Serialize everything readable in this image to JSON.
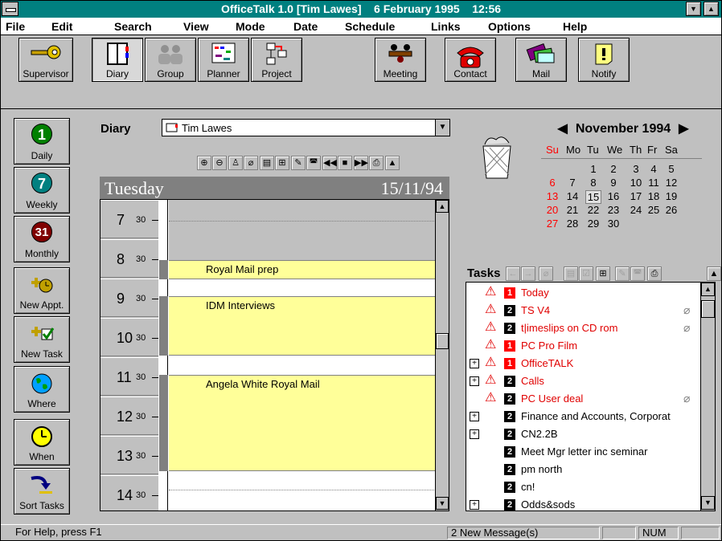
{
  "title": "OfficeTalk 1.0 [Tim Lawes]    6 February 1995    12:56",
  "menu": [
    "File",
    "Edit",
    "Search",
    "View",
    "Mode",
    "Date",
    "Schedule",
    "Links",
    "Options",
    "Help"
  ],
  "toolbar": [
    "Supervisor",
    "Diary",
    "Group",
    "Planner",
    "Project",
    "Meeting",
    "Contact",
    "Mail",
    "Notify"
  ],
  "sidebar": [
    {
      "icon": "1",
      "label": "Daily",
      "color": "#008000"
    },
    {
      "icon": "7",
      "label": "Weekly",
      "color": "#008080"
    },
    {
      "icon": "31",
      "label": "Monthly",
      "color": "#800000"
    },
    {
      "label": "New Appt."
    },
    {
      "label": "New Task"
    },
    {
      "label": "Where"
    },
    {
      "label": "When"
    },
    {
      "label": "Sort Tasks"
    }
  ],
  "diary": {
    "label": "Diary",
    "owner": "Tim Lawes",
    "day": "Tuesday",
    "date": "15/11/94",
    "hours": [
      "7",
      "8",
      "9",
      "10",
      "11",
      "12",
      "13",
      "14"
    ],
    "half": "30",
    "appointments": [
      "Royal Mail prep",
      "IDM Interviews",
      "Angela White Royal Mail"
    ]
  },
  "calendar": {
    "month": "November 1994",
    "weekdays": [
      "Su",
      "Mo",
      "Tu",
      "We",
      "Th",
      "Fr",
      "Sa"
    ],
    "weeks": [
      [
        "",
        "",
        "1",
        "2",
        "3",
        "4",
        "5"
      ],
      [
        "6",
        "7",
        "8",
        "9",
        "10",
        "11",
        "12"
      ],
      [
        "13",
        "14",
        "15",
        "16",
        "17",
        "18",
        "19"
      ],
      [
        "20",
        "21",
        "22",
        "23",
        "24",
        "25",
        "26"
      ],
      [
        "27",
        "28",
        "29",
        "30",
        "",
        "",
        ""
      ]
    ],
    "selected": "15",
    "sunday_color": "#ff0000"
  },
  "tasks": {
    "label": "Tasks",
    "items": [
      {
        "text": "Today",
        "pri": "1",
        "warn": true,
        "red": true,
        "exp": false,
        "clip": false
      },
      {
        "text": "TS V4",
        "pri": "2",
        "warn": true,
        "red": true,
        "exp": false,
        "clip": true
      },
      {
        "text": "t|imeslips on CD rom",
        "pri": "2",
        "warn": true,
        "red": true,
        "exp": false,
        "clip": true
      },
      {
        "text": "PC Pro Film",
        "pri": "1",
        "warn": true,
        "red": true,
        "exp": false,
        "clip": false
      },
      {
        "text": "OfficeTALK",
        "pri": "1",
        "warn": true,
        "red": true,
        "exp": true,
        "clip": false
      },
      {
        "text": "Calls",
        "pri": "2",
        "warn": true,
        "red": true,
        "exp": true,
        "clip": false
      },
      {
        "text": "PC User deal",
        "pri": "2",
        "warn": true,
        "red": true,
        "exp": false,
        "clip": true
      },
      {
        "text": "Finance and Accounts, Corporat",
        "pri": "2",
        "warn": false,
        "red": false,
        "exp": true,
        "clip": false
      },
      {
        "text": "CN2.2B",
        "pri": "2",
        "warn": false,
        "red": false,
        "exp": true,
        "clip": false
      },
      {
        "text": "Meet Mgr letter inc seminar",
        "pri": "2",
        "warn": false,
        "red": false,
        "exp": false,
        "clip": false
      },
      {
        "text": "pm north",
        "pri": "2",
        "warn": false,
        "red": false,
        "exp": false,
        "clip": false
      },
      {
        "text": "cn!",
        "pri": "2",
        "warn": false,
        "red": false,
        "exp": false,
        "clip": false
      },
      {
        "text": "Odds&sods",
        "pri": "2",
        "warn": false,
        "red": false,
        "exp": true,
        "clip": false
      }
    ]
  },
  "status": {
    "help": "For Help, press F1",
    "messages": "2 New Message(s)",
    "num": "NUM"
  },
  "colors": {
    "title_bg": "#008080",
    "appt_bg": "#ffff99",
    "task_red": "#e00000",
    "pri1": "#ff0000",
    "pri2": "#000000"
  }
}
